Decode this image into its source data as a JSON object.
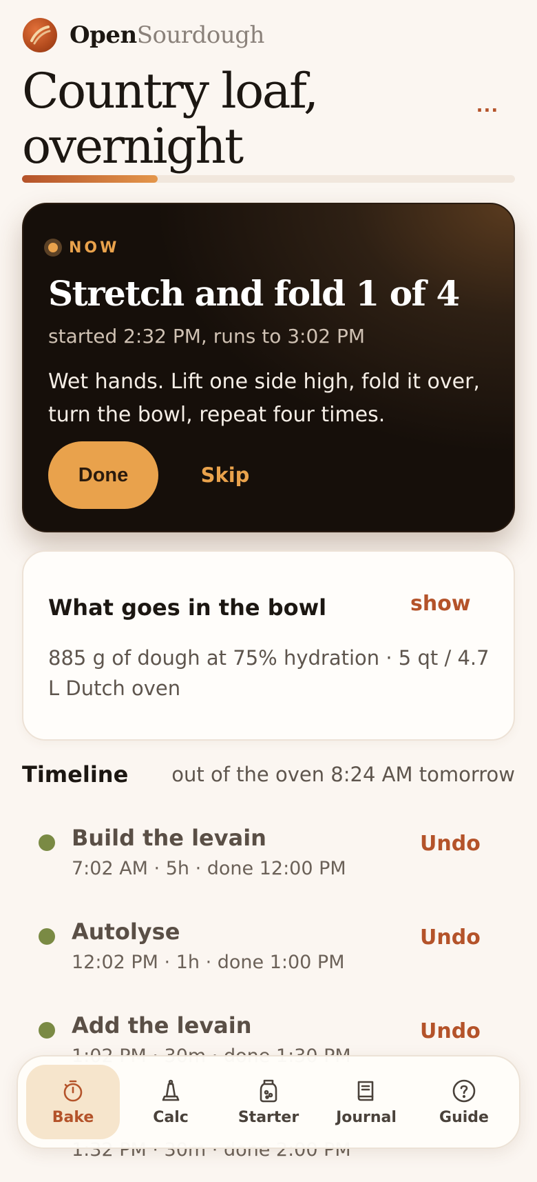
{
  "brand": {
    "name_primary": "Open",
    "name_secondary": "Sourdough"
  },
  "header": {
    "title": "Country loaf, overnight",
    "more_label": "...",
    "progress_fraction": 0.275
  },
  "now_card": {
    "tag": "NOW",
    "title": "Stretch and fold 1 of 4",
    "time_text": "started 2:32 PM, runs to 3:02 PM",
    "description": "Wet hands. Lift one side high, fold it over, turn the bowl, repeat four times.",
    "done_label": "Done",
    "skip_label": "Skip"
  },
  "bowl_card": {
    "title": "What goes in the bowl",
    "toggle_label": "show",
    "description": "885 g of dough at 75% hydration · 5 qt / 4.7 L Dutch oven"
  },
  "timeline": {
    "title": "Timeline",
    "eta": "out of the oven 8:24 AM tomorrow",
    "items": [
      {
        "name": "Build the levain",
        "meta": "7:02 AM · 5h · done 12:00 PM",
        "action": "Undo"
      },
      {
        "name": "Autolyse",
        "meta": "12:02 PM · 1h · done 1:00 PM",
        "action": "Undo"
      },
      {
        "name": "Add the levain",
        "meta": "1:02 PM · 30m · done 1:30 PM",
        "action": "Undo"
      },
      {
        "name": "",
        "meta": "1:32 PM · 30m · done 2:00 PM",
        "action": ""
      }
    ]
  },
  "bottom_nav": {
    "items": [
      {
        "label": "Bake",
        "icon": "timer-icon",
        "active": true
      },
      {
        "label": "Calc",
        "icon": "scale-icon",
        "active": false
      },
      {
        "label": "Starter",
        "icon": "jar-icon",
        "active": false
      },
      {
        "label": "Journal",
        "icon": "book-icon",
        "active": false
      },
      {
        "label": "Guide",
        "icon": "help-icon",
        "active": false
      }
    ]
  },
  "colors": {
    "accent": "#B4532A",
    "amber": "#E9A24C",
    "done_dot": "#7A8A44",
    "background": "#FBF6F1",
    "card_dark": "#160F0A"
  }
}
